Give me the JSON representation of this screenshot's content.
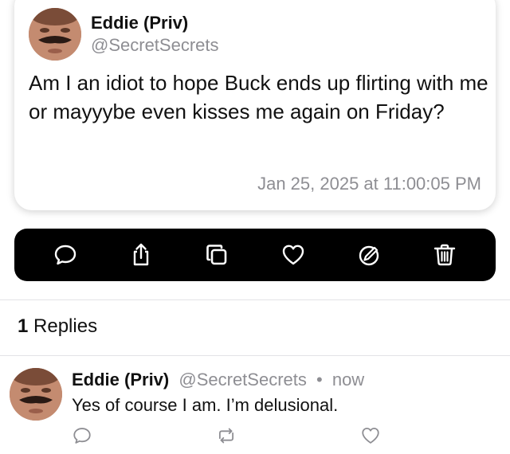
{
  "post": {
    "author_name": "Eddie (Priv)",
    "author_handle": "@SecretSecrets",
    "text": "Am I an idiot to hope Buck ends up flirting with me or mayyybe even kisses me again on Friday?",
    "timestamp": "Jan 25, 2025 at 11:00:05 PM"
  },
  "action_bar": {
    "icons": [
      "comment-icon",
      "share-icon",
      "copy-icon",
      "heart-icon",
      "edit-icon",
      "trash-icon"
    ],
    "background": "#000000",
    "icon_color": "#ffffff"
  },
  "replies": {
    "count": "1",
    "label": "Replies",
    "items": [
      {
        "author_name": "Eddie (Priv)",
        "author_handle": "@SecretSecrets",
        "separator": "•",
        "time": "now",
        "text": "Yes of course I am. I’m delusional."
      }
    ]
  },
  "colors": {
    "secondary_text": "#8e8e93",
    "primary_text": "#111111",
    "divider": "#e3e3e6"
  }
}
